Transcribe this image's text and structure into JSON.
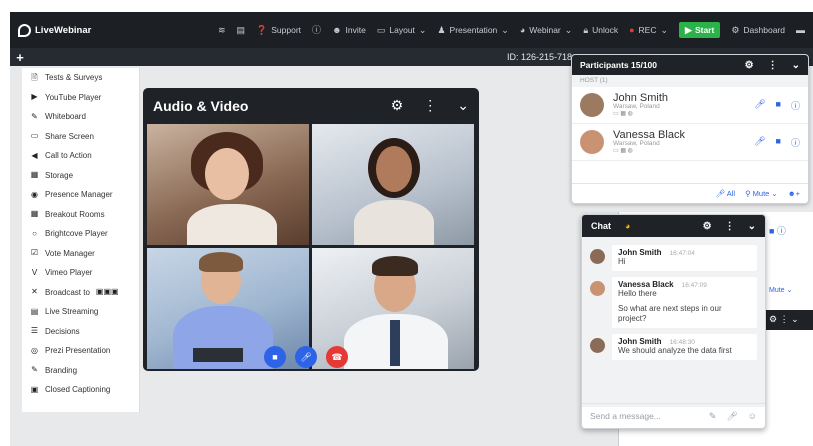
{
  "topbar": {
    "brand": "LiveWebinar",
    "items": [
      "Support",
      "Invite",
      "Layout",
      "Presentation",
      "Webinar",
      "Unlock",
      "REC",
      "Start",
      "Dashboard"
    ]
  },
  "room": {
    "id": "ID: 126-215-718"
  },
  "sidemenu": {
    "items": [
      {
        "label": "Tests & Surveys",
        "icon": "document-icon"
      },
      {
        "label": "YouTube Player",
        "icon": "video-icon"
      },
      {
        "label": "Whiteboard",
        "icon": "pen-icon"
      },
      {
        "label": "Share Screen",
        "icon": "monitor-icon"
      },
      {
        "label": "Call to Action",
        "icon": "megaphone-icon"
      },
      {
        "label": "Storage",
        "icon": "storage-icon"
      },
      {
        "label": "Presence Manager",
        "icon": "eye-icon"
      },
      {
        "label": "Breakout Rooms",
        "icon": "grid-icon"
      },
      {
        "label": "Brightcove Player",
        "icon": "circle-icon"
      },
      {
        "label": "Vote Manager",
        "icon": "vote-icon"
      },
      {
        "label": "Vimeo Player",
        "icon": "vimeo-icon"
      },
      {
        "label": "Broadcast to",
        "icon": "broadcast-icon"
      },
      {
        "label": "Live Streaming",
        "icon": "film-icon"
      },
      {
        "label": "Decisions",
        "icon": "list-icon"
      },
      {
        "label": "Prezi Presentation",
        "icon": "prezi-icon"
      },
      {
        "label": "Branding",
        "icon": "brush-icon"
      },
      {
        "label": "Closed Captioning",
        "icon": "cc-icon"
      }
    ]
  },
  "av": {
    "title": "Audio & Video"
  },
  "participants": {
    "title": "Participants 15/100",
    "host_label": "HOST (1)",
    "list": [
      {
        "name": "John Smith",
        "location": "Warsaw, Poland"
      },
      {
        "name": "Vanessa Black",
        "location": "Warsaw, Poland"
      }
    ],
    "footer_all": "All",
    "footer_mute": "Mute"
  },
  "back_panel": {
    "mute_label": "Mute"
  },
  "chat": {
    "title": "Chat",
    "messages": [
      {
        "name": "John Smith",
        "time": "16:47:04",
        "text": "Hi"
      },
      {
        "name": "Vanessa Black",
        "time": "16:47:09",
        "text": "Hello there",
        "text2": "So what are next steps in our project?"
      },
      {
        "name": "John Smith",
        "time": "16:48:30",
        "text": "We should analyze the data first"
      }
    ],
    "placeholder": "Send a message..."
  },
  "colors": {
    "accent": "#2d63e6",
    "start_green": "#2bb34a",
    "danger": "#e53935",
    "dark": "#1f2226"
  }
}
